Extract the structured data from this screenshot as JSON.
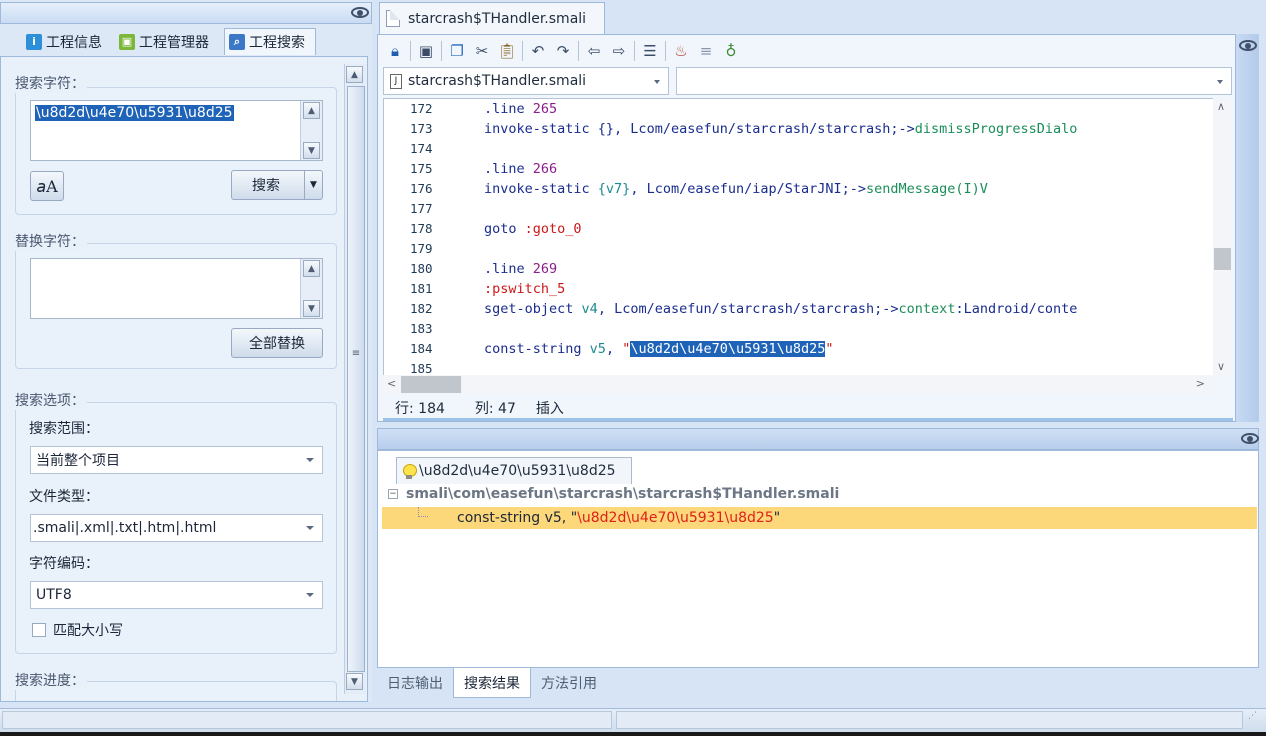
{
  "left_panel": {
    "tabs": [
      {
        "label": "工程信息",
        "icon": "info-icon"
      },
      {
        "label": "工程管理器",
        "icon": "android-icon"
      },
      {
        "label": "工程搜索",
        "icon": "search-icon"
      }
    ],
    "search_group": {
      "title": "搜索字符：",
      "search_text": "\\u8d2d\\u4e70\\u5931\\u8d25",
      "case_icon": "font-size-icon",
      "search_button": "搜索"
    },
    "replace_group": {
      "title": "替换字符：",
      "replace_text": "",
      "replace_all_button": "全部替换"
    },
    "options_group": {
      "title": "搜索选项：",
      "scope_label": "搜索范围：",
      "scope_value": "当前整个项目",
      "filetype_label": "文件类型：",
      "filetype_value": ".smali|.xml|.txt|.htm|.html",
      "encoding_label": "字符编码：",
      "encoding_value": "UTF8",
      "match_case_label": "匹配大小写"
    },
    "progress_group": {
      "title": "搜索进度："
    }
  },
  "editor": {
    "tab_title": "starcrash$THandler.smali",
    "file_combo": "starcrash$THandler.smali",
    "member_combo": "",
    "toolbar_icons": [
      "lock-icon",
      "save-icon",
      "copy-icon",
      "cut-icon",
      "paste-icon",
      "undo-icon",
      "redo-icon",
      "back-icon",
      "forward-icon",
      "format-icon",
      "java-icon",
      "list-icon",
      "bug-icon"
    ],
    "lines": [
      {
        "no": "172",
        "parts": [
          [
            "kw",
            ".line "
          ],
          [
            "num",
            "265"
          ]
        ]
      },
      {
        "no": "173",
        "parts": [
          [
            "kw",
            "invoke-static "
          ],
          [
            "kw",
            "{}, Lcom/easefun/starcrash/starcrash;->"
          ],
          [
            "meth",
            "dismissProgressDialo"
          ]
        ]
      },
      {
        "no": "174",
        "parts": []
      },
      {
        "no": "175",
        "parts": [
          [
            "kw",
            ".line "
          ],
          [
            "num",
            "266"
          ]
        ]
      },
      {
        "no": "176",
        "parts": [
          [
            "kw",
            "invoke-static "
          ],
          [
            "reg",
            "{v7}"
          ],
          [
            "kw",
            ", Lcom/easefun/iap/StarJNI;->"
          ],
          [
            "meth",
            "sendMessage(I)V"
          ]
        ]
      },
      {
        "no": "177",
        "parts": []
      },
      {
        "no": "178",
        "parts": [
          [
            "kw",
            "goto "
          ],
          [
            "lbl",
            ":goto_0"
          ]
        ]
      },
      {
        "no": "179",
        "parts": []
      },
      {
        "no": "180",
        "parts": [
          [
            "kw",
            ".line "
          ],
          [
            "num",
            "269"
          ]
        ]
      },
      {
        "no": "181",
        "parts": [
          [
            "lbl",
            ":pswitch_5"
          ]
        ]
      },
      {
        "no": "182",
        "parts": [
          [
            "kw",
            "sget-object "
          ],
          [
            "reg",
            "v4"
          ],
          [
            "kw",
            ", Lcom/easefun/starcrash/starcrash;->"
          ],
          [
            "meth",
            "context"
          ],
          [
            "kw",
            ":Landroid/conte"
          ]
        ]
      },
      {
        "no": "183",
        "parts": []
      },
      {
        "no": "184",
        "parts": [
          [
            "kw",
            "const-string "
          ],
          [
            "reg",
            "v5"
          ],
          [
            "kw",
            ", "
          ],
          [
            "str",
            "\""
          ],
          [
            "sel",
            "\\u8d2d\\u4e70\\u5931\\u8d25"
          ],
          [
            "str",
            "\""
          ]
        ]
      },
      {
        "no": "185",
        "parts": []
      }
    ],
    "status": {
      "row": "行: 184",
      "col": "列: 47",
      "mode": "插入"
    }
  },
  "results": {
    "tab_label": "\\u8d2d\\u4e70\\u5931\\u8d25",
    "file_path": "smali\\com\\easefun\\starcrash\\starcrash$THandler.smali",
    "hit_prefix": "const-string v5, \"",
    "hit_match": "\\u8d2d\\u4e70\\u5931\\u8d25",
    "hit_suffix": "\"",
    "bottom_tabs": [
      "日志输出",
      "搜索结果",
      "方法引用"
    ]
  },
  "colors": {
    "accent_selection": "#1e63b8",
    "hit_highlight": "#fcd87a",
    "panel_bg": "#d6e4f5"
  }
}
